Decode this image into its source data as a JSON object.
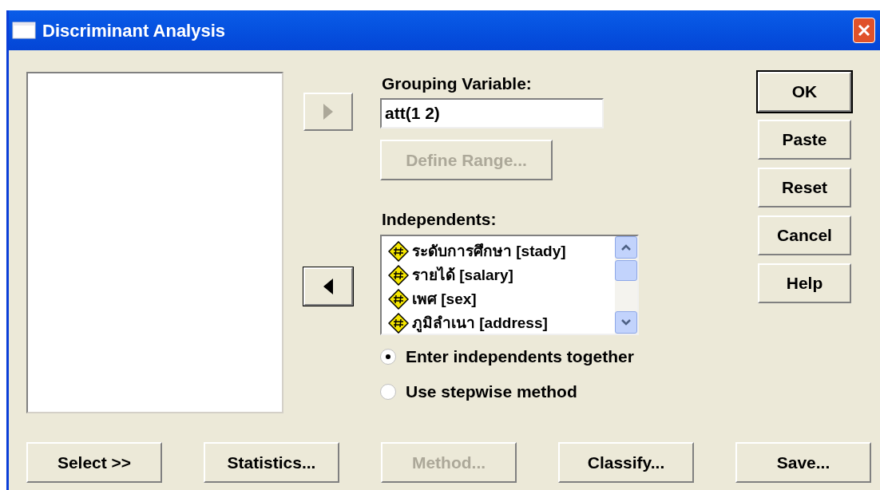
{
  "window": {
    "title": "Discriminant Analysis"
  },
  "transfer_buttons": [
    {
      "kind": "right",
      "disabled": true
    },
    {
      "kind": "left",
      "disabled": false
    }
  ],
  "grouping": {
    "label": "Grouping Variable:",
    "value": "att(1 2)",
    "define_range": {
      "label": "Define Range...",
      "disabled": true
    }
  },
  "independents": {
    "label": "Independents:",
    "items": [
      {
        "text": "ระดับการศึกษา [stady]"
      },
      {
        "text": "รายได้ [salary]"
      },
      {
        "text": "เพศ [sex]"
      },
      {
        "text": "ภูมิลำเนา [address]"
      }
    ]
  },
  "method": [
    {
      "label": "Enter independents together",
      "selected": true
    },
    {
      "label": "Use stepwise method",
      "selected": false
    }
  ],
  "side_buttons": [
    {
      "label": "OK",
      "default": true
    },
    {
      "label": "Paste",
      "default": false
    },
    {
      "label": "Reset",
      "default": false
    },
    {
      "label": "Cancel",
      "default": false
    },
    {
      "label": "Help",
      "default": false
    }
  ],
  "bottom_buttons": [
    {
      "label": "Select >>",
      "disabled": false
    },
    {
      "label": "Statistics...",
      "disabled": false
    },
    {
      "label": "Method...",
      "disabled": true
    },
    {
      "label": "Classify...",
      "disabled": false
    },
    {
      "label": "Save...",
      "disabled": false
    }
  ]
}
